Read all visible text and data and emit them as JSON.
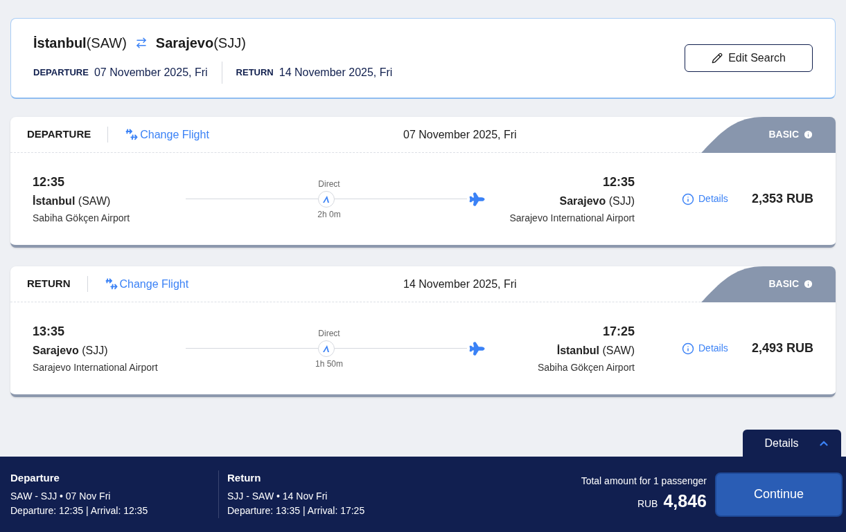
{
  "search": {
    "origin": {
      "city": "İstanbul",
      "code": "(SAW)"
    },
    "destination": {
      "city": "Sarajevo",
      "code": "(SJJ)"
    },
    "dates": [
      {
        "label": "DEPARTURE",
        "value": "07 November 2025, Fri"
      },
      {
        "label": "RETURN",
        "value": "14 November 2025, Fri"
      }
    ],
    "edit_button": "Edit Search"
  },
  "flights": [
    {
      "leg": "DEPARTURE",
      "change": "Change Flight",
      "date": "07 November 2025, Fri",
      "fare": "BASIC",
      "stops": "Direct",
      "duration": "2h 0m",
      "dep_time": "12:35",
      "dep_city": "İstanbul",
      "dep_code": "(SAW)",
      "dep_airport": "Sabiha Gökçen Airport",
      "arr_time": "12:35",
      "arr_city": "Sarajevo",
      "arr_code": "(SJJ)",
      "arr_airport": "Sarajevo International Airport",
      "details": "Details",
      "price": "2,353",
      "currency": "RUB"
    },
    {
      "leg": "RETURN",
      "change": "Change Flight",
      "date": "14 November 2025, Fri",
      "fare": "BASIC",
      "stops": "Direct",
      "duration": "1h 50m",
      "dep_time": "13:35",
      "dep_city": "Sarajevo",
      "dep_code": "(SJJ)",
      "dep_airport": "Sarajevo International Airport",
      "arr_time": "17:25",
      "arr_city": "İstanbul",
      "arr_code": "(SAW)",
      "arr_airport": "Sabiha Gökçen Airport",
      "details": "Details",
      "price": "2,493",
      "currency": "RUB"
    }
  ],
  "footer": {
    "details_tab": "Details",
    "legs": [
      {
        "title": "Departure",
        "route": "SAW - SJJ • 07 Nov Fri",
        "times": "Departure: 12:35 | Arrival: 12:35"
      },
      {
        "title": "Return",
        "route": "SJJ - SAW • 14 Nov Fri",
        "times": "Departure: 13:35 | Arrival: 17:25"
      }
    ],
    "total_label": "Total amount for 1 passenger",
    "total_currency": "RUB",
    "total": "4,846",
    "continue": "Continue"
  }
}
